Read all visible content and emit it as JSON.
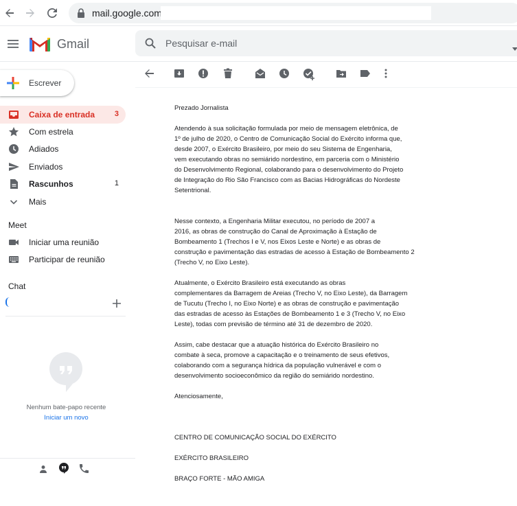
{
  "browser": {
    "url": "mail.google.com",
    "icons": [
      "back-arrow-icon",
      "forward-arrow-icon",
      "reload-icon",
      "lock-icon"
    ]
  },
  "header": {
    "app_name": "Gmail",
    "search_placeholder": "Pesquisar e-mail",
    "brand_red": "#d93025"
  },
  "sidebar": {
    "compose_label": "Escrever",
    "items": [
      {
        "label": "Caixa de entrada",
        "count": "3",
        "icon": "inbox-icon"
      },
      {
        "label": "Com estrela",
        "count": "",
        "icon": "star-icon"
      },
      {
        "label": "Adiados",
        "count": "",
        "icon": "clock-icon"
      },
      {
        "label": "Enviados",
        "count": "",
        "icon": "send-icon"
      },
      {
        "label": "Rascunhos",
        "count": "1",
        "icon": "draft-icon"
      },
      {
        "label": "Mais",
        "count": "",
        "icon": "chevron-down-icon"
      }
    ],
    "meet": {
      "title": "Meet",
      "items": [
        {
          "label": "Iniciar uma reunião",
          "icon": "video-icon"
        },
        {
          "label": "Participar de reunião",
          "icon": "keyboard-icon"
        }
      ]
    },
    "chat": {
      "title": "Chat",
      "empty_text": "Nenhum bate-papo recente",
      "start_link": "Iniciar um novo"
    }
  },
  "toolbar": {
    "icons": [
      "back-icon",
      "archive-icon",
      "report-spam-icon",
      "delete-icon",
      "mark-unread-icon",
      "snooze-icon",
      "add-task-icon",
      "move-to-icon",
      "label-icon",
      "more-icon"
    ]
  },
  "message": {
    "greeting": "Prezado Jornalista",
    "p1": [
      "Atendendo à sua solicitação formulada por meio de mensagem eletrônica, de",
      "1º de julho de 2020, o Centro de Comunicação Social do Exército informa que,",
      "desde 2007, o Exército Brasileiro, por meio do seu Sistema de Engenharia,",
      "vem executando obras no semiárido nordestino, em parceria com o Ministério",
      "do Desenvolvimento Regional, colaborando para o desenvolvimento do Projeto",
      "de Integração do Rio São Francisco com as Bacias Hidrográficas do Nordeste",
      "Setentrional."
    ],
    "p2": [
      "   Nesse contexto, a Engenharia Militar executou, no período de 2007 a",
      "2016, as obras de construção do Canal de Aproximação à Estação de",
      "Bombeamento 1 (Trechos I e V, nos Eixos Leste e Norte) e as obras de",
      "construção e pavimentação das estradas de acesso à Estação de Bombeamento 2",
      "(Trecho V, no Eixo Leste)."
    ],
    "p3": [
      "   Atualmente, o Exército Brasileiro está executando as obras",
      "complementares da Barragem de Areias (Trecho V, no Eixo Leste), da Barragem",
      "de Tucutu (Trecho I, no Eixo Norte) e as obras de construção e pavimentação",
      "das estradas de acesso às Estações de Bombeamento 1 e 3 (Trecho V, no Eixo",
      "Leste), todas com previsão de término até 31 de dezembro de 2020."
    ],
    "p4": [
      "   Assim, cabe destacar que a atuação histórica do Exército Brasileiro no",
      "combate à seca, promove a capacitação e o treinamento de seus efetivos,",
      "colaborando com a segurança hídrica da população vulnerável e com o",
      "desenvolvimento socioeconômico da região do semiárido nordestino."
    ],
    "closing": "Atenciosamente,",
    "signature_1": "CENTRO DE COMUNICAÇÃO SOCIAL DO EXÉRCITO",
    "signature_2": "EXÉRCITO BRASILEIRO",
    "signature_3": "BRAÇO FORTE - MÃO AMIGA"
  }
}
